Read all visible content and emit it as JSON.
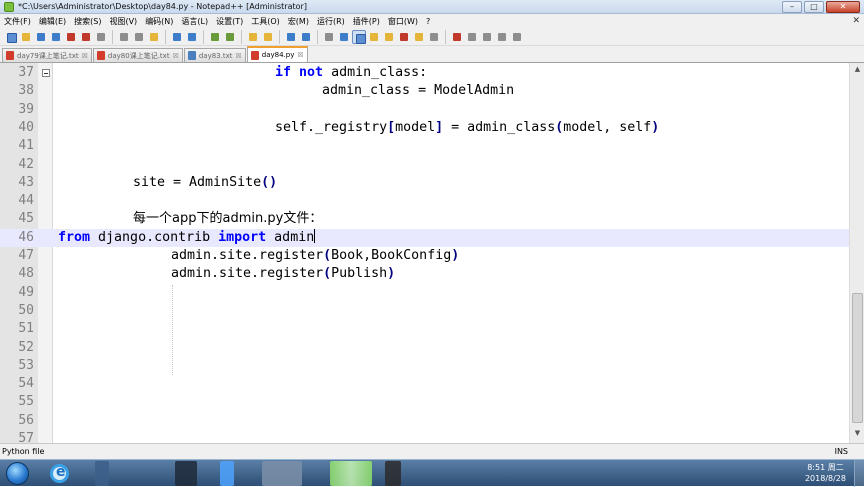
{
  "window": {
    "title": "*C:\\Users\\Administrator\\Desktop\\day84.py - Notepad++ [Administrator]",
    "controls": {
      "minimize": "–",
      "maximize": "□",
      "close": "✕"
    }
  },
  "menu": {
    "items": [
      "文件(F)",
      "编辑(E)",
      "搜索(S)",
      "视图(V)",
      "编码(N)",
      "语言(L)",
      "设置(T)",
      "工具(O)",
      "宏(M)",
      "运行(R)",
      "插件(P)",
      "窗口(W)",
      "?"
    ],
    "close_glyph": "✕"
  },
  "tabs": [
    {
      "label": "day79课上笔记.txt",
      "close": "☒",
      "active": false
    },
    {
      "label": "day80课上笔记.txt",
      "close": "☒",
      "active": false
    },
    {
      "label": "day83.txt",
      "close": "☒",
      "active": false
    },
    {
      "label": "day84.py",
      "close": "☒",
      "active": true
    }
  ],
  "editor": {
    "lines": [
      {
        "num": "37"
      },
      {
        "num": "38"
      },
      {
        "num": "39"
      },
      {
        "num": "40"
      },
      {
        "num": "41"
      },
      {
        "num": "42"
      },
      {
        "num": "43"
      },
      {
        "num": "44"
      },
      {
        "num": "45"
      },
      {
        "num": "46"
      },
      {
        "num": "47"
      },
      {
        "num": "48"
      },
      {
        "num": "49"
      },
      {
        "num": "50"
      },
      {
        "num": "51"
      },
      {
        "num": "52"
      },
      {
        "num": "53"
      },
      {
        "num": "54"
      },
      {
        "num": "55"
      },
      {
        "num": "56"
      },
      {
        "num": "57"
      }
    ],
    "code": {
      "l37_kw1": "if",
      "l37_kw2": "not",
      "l37_rest": " admin_class:",
      "l38": "admin_class = ModelAdmin",
      "l40_a": "self._registry",
      "l40_b": "[",
      "l40_c": "model",
      "l40_d": "]",
      "l40_e": " = admin_class",
      "l40_f": "(",
      "l40_g": "model, self",
      "l40_h": ")",
      "l43_a": "site = AdminSite",
      "l43_b": "()",
      "l45_cn1": "每一个",
      "l45_mid": "app",
      "l45_cn2": "下的",
      "l45_mid2": "admin.py",
      "l45_cn3": "文件：",
      "l46_kw1": "from",
      "l46_mid": " django.contrib ",
      "l46_kw2": "import",
      "l46_rest": " admin",
      "l47_a": "admin.site.register",
      "l47_b": "(",
      "l47_c": "Book,BookConfig",
      "l47_d": ")",
      "l48_a": "admin.site.register",
      "l48_b": "(",
      "l48_c": "Publish",
      "l48_d": ")"
    }
  },
  "status": {
    "language": "Python file",
    "mode": "INS"
  },
  "taskbar": {
    "time": "8:51 周二",
    "date": "2018/8/28"
  }
}
